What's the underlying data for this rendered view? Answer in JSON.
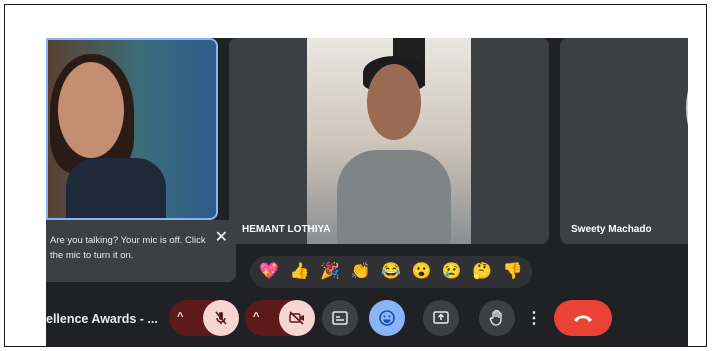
{
  "participants": {
    "tile2_name": "HEMANT LOTHIYA",
    "tile3_name": "Sweety Machado"
  },
  "mic_toast": {
    "message": "Are you talking? Your mic is off. Click the mic to turn it on.",
    "close_glyph": "✕"
  },
  "reactions": [
    "💖",
    "👍",
    "🎉",
    "👏",
    "😂",
    "😮",
    "😢",
    "🤔",
    "👎"
  ],
  "toolbar": {
    "meeting_title": "ellence Awards - ...",
    "caret_glyph": "^",
    "more_glyph": "⋮"
  },
  "colors": {
    "background": "#202124",
    "tile": "#3c4043",
    "muted_dark": "#5c1a1b",
    "muted_light": "#f6d5d2",
    "accent_blue": "#8ab4f8",
    "hangup_red": "#ea4335"
  }
}
